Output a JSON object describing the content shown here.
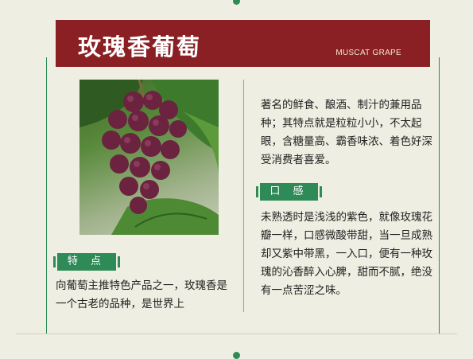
{
  "header": {
    "title": "玫瑰香葡萄",
    "subtitle": "MUSCAT GRAPE"
  },
  "sections": {
    "feature_label": "特 点",
    "taste_label": "口 感"
  },
  "content": {
    "left_paragraph": "向葡萄主推特色产品之一，玫瑰香是一个古老的品种，是世界上",
    "right_top_paragraph": "著名的鲜食、酿酒、制汁的兼用品种；其特点就是粒粒小小，不太起眼，含糖量高、霸香味浓、着色好深受消费者喜爱。",
    "right_bottom_paragraph": "未熟透时是浅浅的紫色，就像玫瑰花瓣一样，口感微酸带甜，当一旦成熟却又紫中带黑，一入口，便有一种玫瑰的沁香醉入心脾，甜而不腻，绝没有一点苦涩之味。"
  },
  "colors": {
    "banner": "#8a2023",
    "accent_green": "#2e8a57",
    "background": "#efeee2"
  },
  "icons": {
    "photo": "grape-bunch-photo"
  }
}
